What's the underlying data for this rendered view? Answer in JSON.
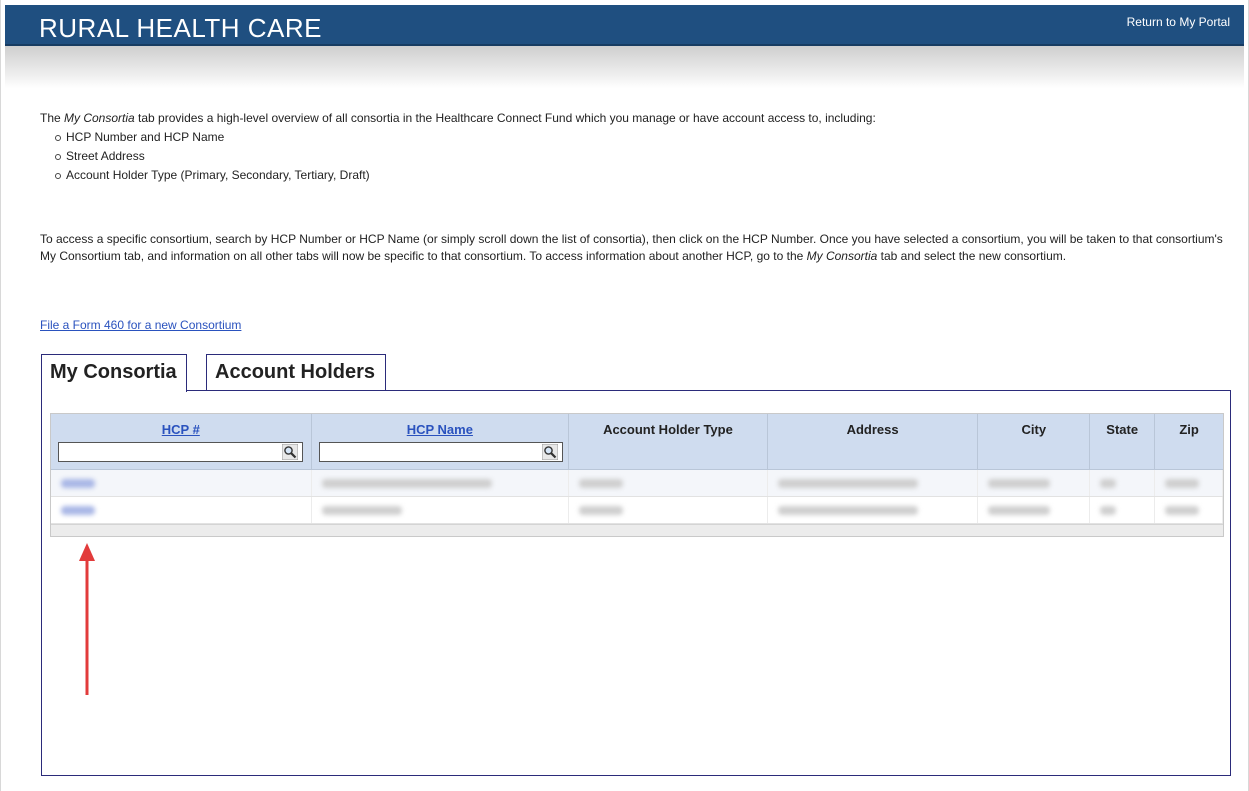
{
  "header": {
    "brand": "RURAL HEALTH CARE",
    "portal_link": "Return to My Portal"
  },
  "intro": {
    "lead_before": "The ",
    "lead_em": "My Consortia",
    "lead_after": " tab provides a high-level overview of all consortia in the Healthcare Connect Fund which you manage or have account access to, including:",
    "features": [
      "HCP Number and HCP Name",
      "Street Address",
      "Account Holder Type (Primary, Secondary, Tertiary, Draft)"
    ]
  },
  "access_text": {
    "part1": "To access a specific consortium, search by HCP Number or HCP Name (or simply scroll down the list of consortia), then click on the HCP Number. Once you have selected a consortium, you will be taken to that consortium's My Consortium tab, and information on all other tabs will now be specific to that consortium. To access information about another HCP, go to the ",
    "em": "My Consortia",
    "part2": " tab and select the new consortium."
  },
  "form_link": "File a Form 460 for a new Consortium",
  "tabs": [
    {
      "label": "My Consortia",
      "active": true
    },
    {
      "label": "Account Holders",
      "active": false
    }
  ],
  "table": {
    "columns": [
      {
        "label": "HCP #",
        "link": true,
        "filter": true
      },
      {
        "label": "HCP Name",
        "link": true,
        "filter": true
      },
      {
        "label": "Account Holder Type",
        "link": false,
        "filter": false
      },
      {
        "label": "Address",
        "link": false,
        "filter": false
      },
      {
        "label": "City",
        "link": false,
        "filter": false
      },
      {
        "label": "State",
        "link": false,
        "filter": false
      },
      {
        "label": "Zip",
        "link": false,
        "filter": false
      }
    ],
    "filter_values": {
      "hcp_number": "",
      "hcp_name": ""
    },
    "rows_note": "row contents obscured (blurred) in screenshot"
  },
  "icons": {
    "filter_search": "magnifier-icon",
    "annotation": "red-up-arrow-icon"
  },
  "colors": {
    "header_bg": "#1f4f80",
    "link": "#2a52be",
    "table_header_bg": "#cfdcef",
    "panel_border": "#2b2b7a",
    "annotation_arrow": "#e23b3b"
  }
}
